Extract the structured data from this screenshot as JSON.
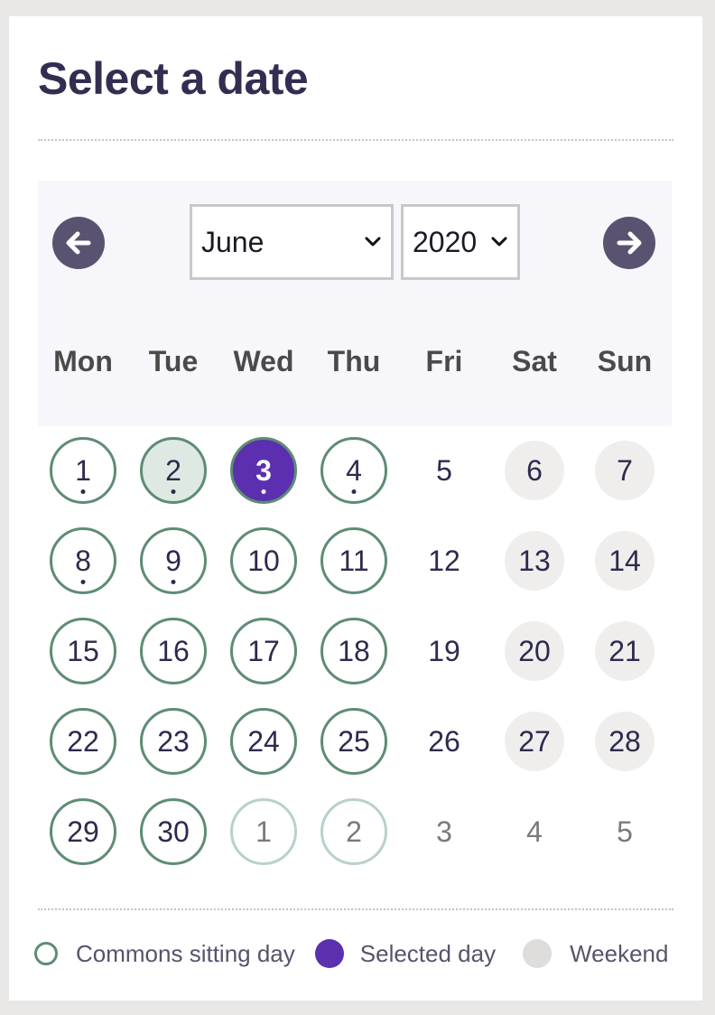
{
  "header": {
    "title": "Select a date"
  },
  "nav": {
    "prev_icon": "arrow-left-icon",
    "next_icon": "arrow-right-icon",
    "month": "June",
    "year": "2020"
  },
  "weekdays": [
    "Mon",
    "Tue",
    "Wed",
    "Thu",
    "Fri",
    "Sat",
    "Sun"
  ],
  "calendar": {
    "weeks": [
      [
        {
          "label": "1",
          "type": "sitting",
          "dot": true
        },
        {
          "label": "2",
          "type": "sitting-light",
          "dot": true
        },
        {
          "label": "3",
          "type": "selected",
          "dot": true
        },
        {
          "label": "4",
          "type": "sitting",
          "dot": true
        },
        {
          "label": "5",
          "type": "plain"
        },
        {
          "label": "6",
          "type": "weekend"
        },
        {
          "label": "7",
          "type": "weekend"
        }
      ],
      [
        {
          "label": "8",
          "type": "sitting",
          "dot": true
        },
        {
          "label": "9",
          "type": "sitting",
          "dot": true
        },
        {
          "label": "10",
          "type": "sitting"
        },
        {
          "label": "11",
          "type": "sitting"
        },
        {
          "label": "12",
          "type": "plain"
        },
        {
          "label": "13",
          "type": "weekend"
        },
        {
          "label": "14",
          "type": "weekend"
        }
      ],
      [
        {
          "label": "15",
          "type": "sitting"
        },
        {
          "label": "16",
          "type": "sitting"
        },
        {
          "label": "17",
          "type": "sitting"
        },
        {
          "label": "18",
          "type": "sitting"
        },
        {
          "label": "19",
          "type": "plain"
        },
        {
          "label": "20",
          "type": "weekend"
        },
        {
          "label": "21",
          "type": "weekend"
        }
      ],
      [
        {
          "label": "22",
          "type": "sitting"
        },
        {
          "label": "23",
          "type": "sitting"
        },
        {
          "label": "24",
          "type": "sitting"
        },
        {
          "label": "25",
          "type": "sitting"
        },
        {
          "label": "26",
          "type": "plain"
        },
        {
          "label": "27",
          "type": "weekend"
        },
        {
          "label": "28",
          "type": "weekend"
        }
      ],
      [
        {
          "label": "29",
          "type": "sitting"
        },
        {
          "label": "30",
          "type": "sitting"
        },
        {
          "label": "1",
          "type": "other-sitting"
        },
        {
          "label": "2",
          "type": "other-sitting"
        },
        {
          "label": "3",
          "type": "other"
        },
        {
          "label": "4",
          "type": "other"
        },
        {
          "label": "5",
          "type": "other"
        }
      ]
    ]
  },
  "legend": {
    "sitting_label": "Commons sitting day",
    "selected_label": "Selected day",
    "weekend_label": "Weekend"
  },
  "colors": {
    "sitting_border": "#5e8c74",
    "selected_fill": "#5b2fb0",
    "weekend_fill": "#efeeed",
    "nav_button": "#595371"
  }
}
